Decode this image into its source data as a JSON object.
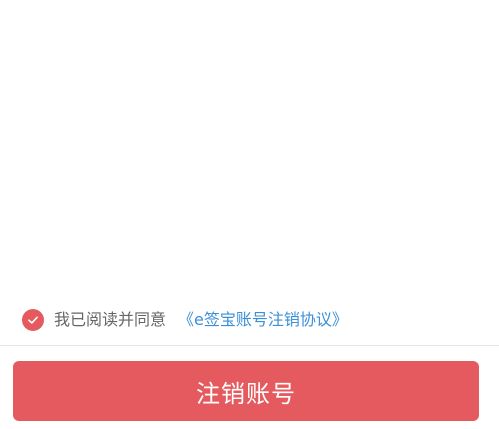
{
  "agreement": {
    "checked": true,
    "text": "我已阅读并同意",
    "link_text": "《e签宝账号注销协议》",
    "icon": "check-icon"
  },
  "actions": {
    "primary_label": "注销账号"
  },
  "colors": {
    "accent": "#e55a5f",
    "link": "#3a8fd6",
    "text_muted": "#666666",
    "divider": "#e6e6e6",
    "background": "#ffffff"
  }
}
